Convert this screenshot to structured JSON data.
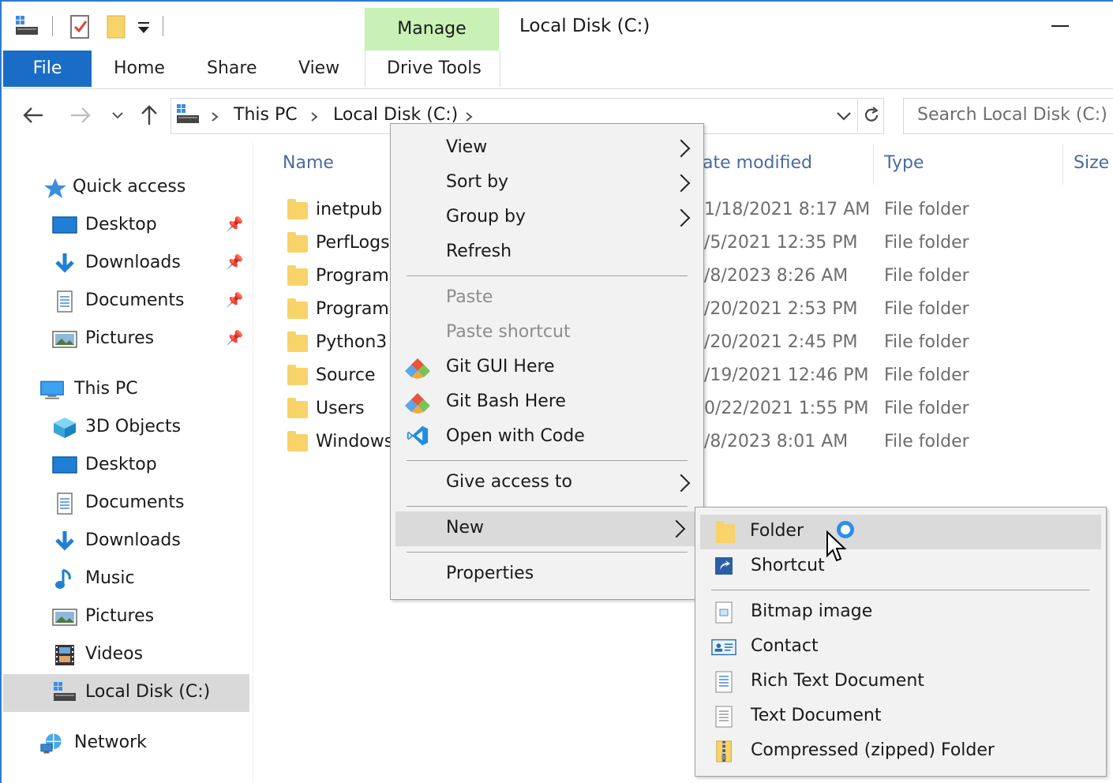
{
  "window": {
    "title": "Local Disk (C:)",
    "context_tab": "Manage"
  },
  "ribbon": {
    "tabs": [
      "File",
      "Home",
      "Share",
      "View",
      "Drive Tools"
    ]
  },
  "address": {
    "breadcrumb": [
      "This PC",
      "Local Disk (C:)"
    ],
    "search_placeholder": "Search Local Disk (C:)"
  },
  "nav": {
    "quick_access": "Quick access",
    "quick_items": [
      "Desktop",
      "Downloads",
      "Documents",
      "Pictures"
    ],
    "this_pc": "This PC",
    "pc_items": [
      "3D Objects",
      "Desktop",
      "Documents",
      "Downloads",
      "Music",
      "Pictures",
      "Videos",
      "Local Disk (C:)"
    ],
    "network": "Network"
  },
  "list": {
    "columns": [
      "Name",
      "Date modified",
      "Type",
      "Size"
    ],
    "rows": [
      {
        "name": "inetpub",
        "date": "1/18/2021 8:17 AM",
        "type": "File folder"
      },
      {
        "name": "PerfLogs",
        "date": "/5/2021 12:35 PM",
        "type": "File folder"
      },
      {
        "name": "Program",
        "date": "/8/2023 8:26 AM",
        "type": "File folder"
      },
      {
        "name": "Program",
        "date": "/20/2021 2:53 PM",
        "type": "File folder"
      },
      {
        "name": "Python3",
        "date": "/20/2021 2:45 PM",
        "type": "File folder"
      },
      {
        "name": "Source",
        "date": "/19/2021 12:46 PM",
        "type": "File folder"
      },
      {
        "name": "Users",
        "date": "0/22/2021 1:55 PM",
        "type": "File folder"
      },
      {
        "name": "Windows",
        "date": "/8/2023 8:01 AM",
        "type": "File folder"
      }
    ],
    "date_header_visible": "ate modified"
  },
  "context_menu": {
    "items": [
      "View",
      "Sort by",
      "Group by",
      "Refresh",
      "Paste",
      "Paste shortcut",
      "Git GUI Here",
      "Git Bash Here",
      "Open with Code",
      "Give access to",
      "New",
      "Properties"
    ]
  },
  "new_submenu": {
    "items": [
      "Folder",
      "Shortcut",
      "Bitmap image",
      "Contact",
      "Rich Text Document",
      "Text Document",
      "Compressed (zipped) Folder"
    ]
  },
  "colors": {
    "accent": "#1a6dc6",
    "manage_tab": "#c9f0b5",
    "menu_bg": "#f2f2f2",
    "folder": "#f8d36a"
  }
}
